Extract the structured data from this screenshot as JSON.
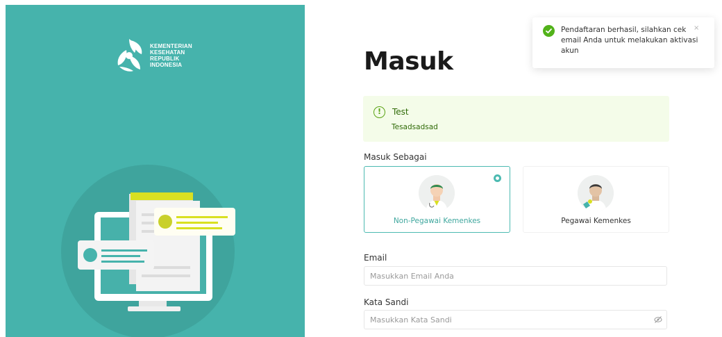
{
  "brand": {
    "logo_lines": [
      "KEMENTERIAN",
      "KESEHATAN",
      "REPUBLIK",
      "INDONESIA"
    ]
  },
  "login": {
    "title": "Masuk",
    "alert": {
      "title": "Test",
      "description": "Tesadsadsad",
      "icon": "info-circle-icon",
      "color": "#5aa314"
    },
    "role_label": "Masuk Sebagai",
    "roles": [
      {
        "label": "Non-Pegawai Kemenkes",
        "selected": true
      },
      {
        "label": "Pegawai Kemenkes",
        "selected": false
      }
    ],
    "email": {
      "label": "Email",
      "placeholder": "Masukkan Email Anda",
      "value": ""
    },
    "password": {
      "label": "Kata Sandi",
      "placeholder": "Masukkan Kata Sandi",
      "value": "",
      "toggle_icon": "eye-off-icon"
    }
  },
  "toast": {
    "message": "Pendaftaran berhasil, silahkan cek email Anda untuk melakukan aktivasi akun",
    "icon": "check-circle-icon",
    "close_icon": "close-icon",
    "close_symbol": "×",
    "color": "#52b21a"
  },
  "colors": {
    "panel": "#46b3ac",
    "accent": "#4cbab1"
  }
}
